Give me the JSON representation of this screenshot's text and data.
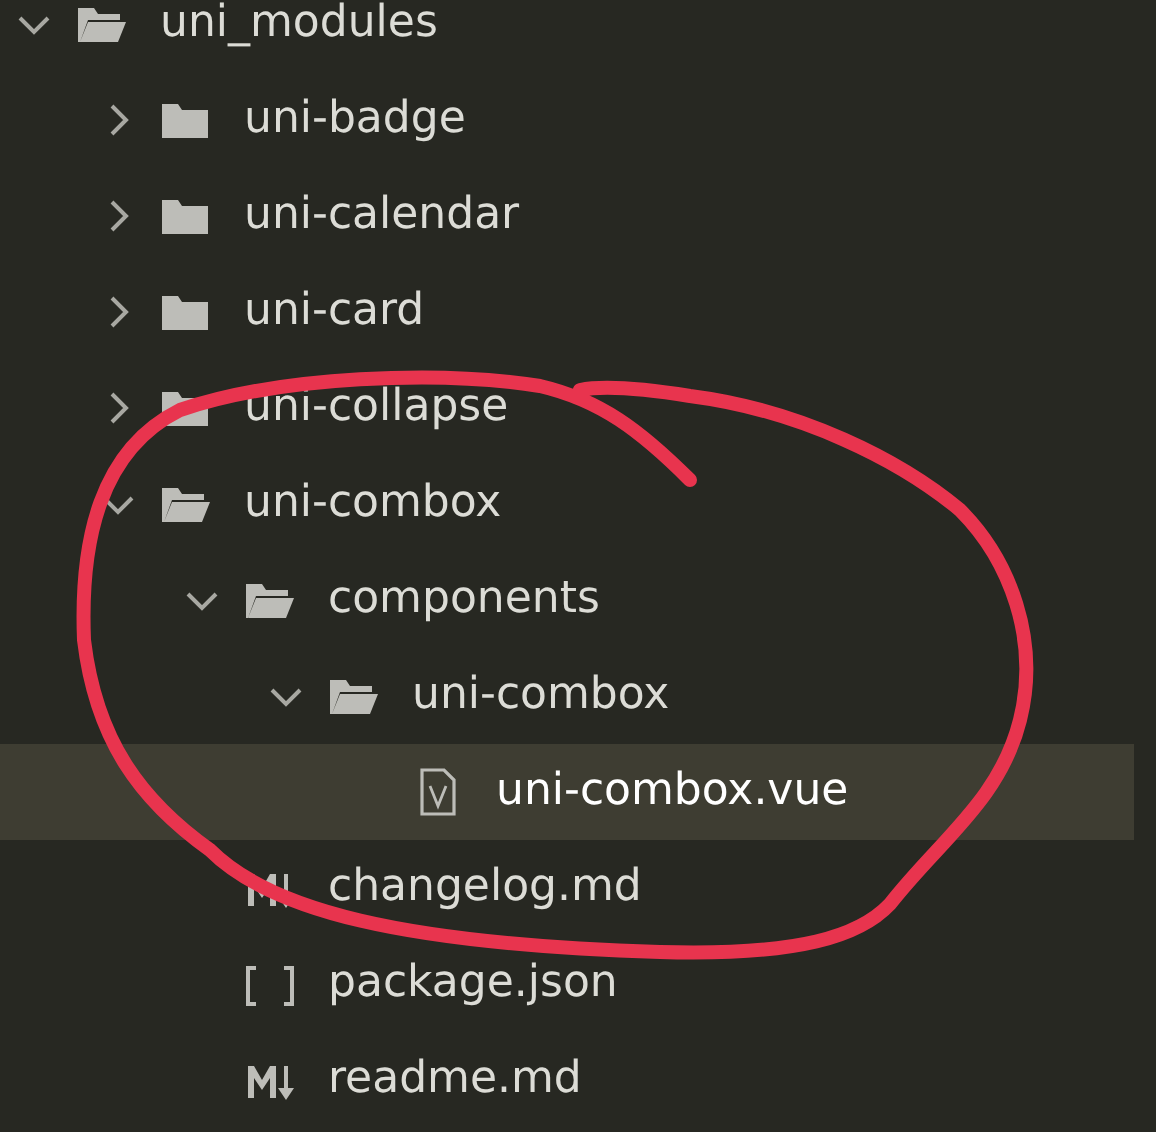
{
  "tree": [
    {
      "name": "uni_modules",
      "kind": "folder",
      "expanded": true,
      "selected": false,
      "children": [
        {
          "name": "uni-badge",
          "kind": "folder",
          "expanded": false,
          "selected": false
        },
        {
          "name": "uni-calendar",
          "kind": "folder",
          "expanded": false,
          "selected": false
        },
        {
          "name": "uni-card",
          "kind": "folder",
          "expanded": false,
          "selected": false
        },
        {
          "name": "uni-collapse",
          "kind": "folder",
          "expanded": false,
          "selected": false
        },
        {
          "name": "uni-combox",
          "kind": "folder",
          "expanded": true,
          "selected": false,
          "children": [
            {
              "name": "components",
              "kind": "folder",
              "expanded": true,
              "selected": false,
              "children": [
                {
                  "name": "uni-combox",
                  "kind": "folder",
                  "expanded": true,
                  "selected": false,
                  "children": [
                    {
                      "name": "uni-combox.vue",
                      "kind": "vue",
                      "selected": true
                    }
                  ]
                }
              ]
            },
            {
              "name": "changelog.md",
              "kind": "markdown",
              "selected": false
            },
            {
              "name": "package.json",
              "kind": "json",
              "selected": false
            },
            {
              "name": "readme.md",
              "kind": "markdown",
              "selected": false
            }
          ]
        }
      ]
    }
  ]
}
